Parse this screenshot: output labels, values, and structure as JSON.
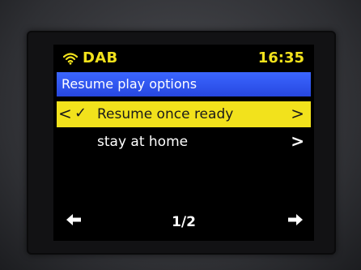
{
  "status": {
    "source": "DAB",
    "time": "16:35",
    "wifi_icon": "wifi-icon",
    "accent_color": "#f2e21c"
  },
  "menu": {
    "title": "Resume play options",
    "title_bar_color": "#2f55f0",
    "items": [
      {
        "label": "Resume once ready",
        "selected": true,
        "checked": true
      },
      {
        "label": "stay at home",
        "selected": false,
        "checked": false
      }
    ]
  },
  "footer": {
    "page": "1/2",
    "prev_icon": "arrow-left-icon",
    "next_icon": "arrow-right-icon"
  },
  "glyphs": {
    "chevron_left": "<",
    "check": "✓",
    "chevron_right": ">",
    "arrow_left": "🡄",
    "arrow_right": "🡆"
  }
}
